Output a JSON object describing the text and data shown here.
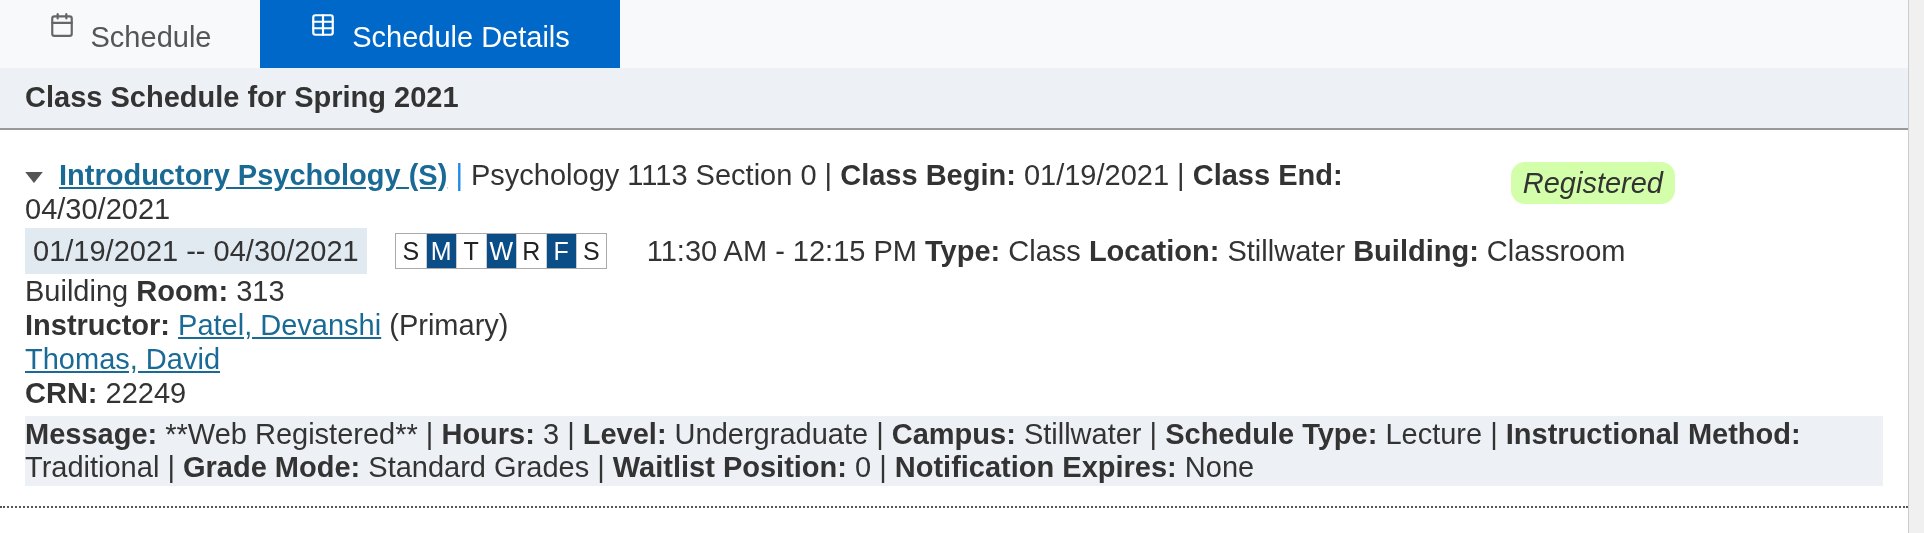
{
  "tabs": [
    {
      "label": "Schedule",
      "kind": "calendar",
      "selected": false
    },
    {
      "label": "Schedule Details",
      "kind": "table",
      "selected": true
    }
  ],
  "section_title": "Class Schedule for Spring 2021",
  "course": {
    "expanded": true,
    "title": "Introductory Psychology (S)",
    "separator": "|",
    "summary": [
      "Psychology 1113 Section 0 | **Class Begin:** 01/19/2021 | **Class End:**",
      "04/30/2021"
    ],
    "status": "Registered",
    "date_range": "01/19/2021 -- 04/30/2021",
    "days": [
      {
        "label": "S",
        "selected": false
      },
      {
        "label": "M",
        "selected": true
      },
      {
        "label": "T",
        "selected": false
      },
      {
        "label": "W",
        "selected": true
      },
      {
        "label": "R",
        "selected": false
      },
      {
        "label": "F",
        "selected": true
      },
      {
        "label": "S",
        "selected": false
      }
    ],
    "meeting": [
      "11:30 AM - 12:15 PM **Type:** Class **Location:** Stillwater **Building:** Classroom",
      "Building **Room:** 313"
    ],
    "instructor_label": "Instructor:",
    "instructors": [
      {
        "name": "Patel, Devanshi",
        "note": "(Primary)"
      },
      {
        "name": "Thomas, David"
      }
    ],
    "crn": "**CRN:** 22249",
    "message": [
      {
        "text": "Message:",
        "bold": true
      },
      {
        "text": " **Web Registered** | ",
        "bold": false
      },
      {
        "text": "Hours:",
        "bold": true
      },
      {
        "text": " 3 | ",
        "bold": false
      },
      {
        "text": "Level:",
        "bold": true
      },
      {
        "text": " Undergraduate | ",
        "bold": false
      },
      {
        "text": "Campus:",
        "bold": true
      },
      {
        "text": " Stillwater | ",
        "bold": false
      },
      {
        "text": "Schedule Type:",
        "bold": true
      },
      {
        "text": " Lecture | ",
        "bold": false
      },
      {
        "text": "Instructional Method:",
        "bold": true
      },
      {
        "text": " Traditional | ",
        "bold": false
      },
      {
        "text": "Grade Mode:",
        "bold": true
      },
      {
        "text": " Standard Grades | ",
        "bold": false
      },
      {
        "text": "Waitlist Position:",
        "bold": true
      },
      {
        "text": " 0 | ",
        "bold": false
      },
      {
        "text": "Notification Expires:",
        "bold": true
      },
      {
        "text": " None",
        "bold": false
      }
    ]
  }
}
